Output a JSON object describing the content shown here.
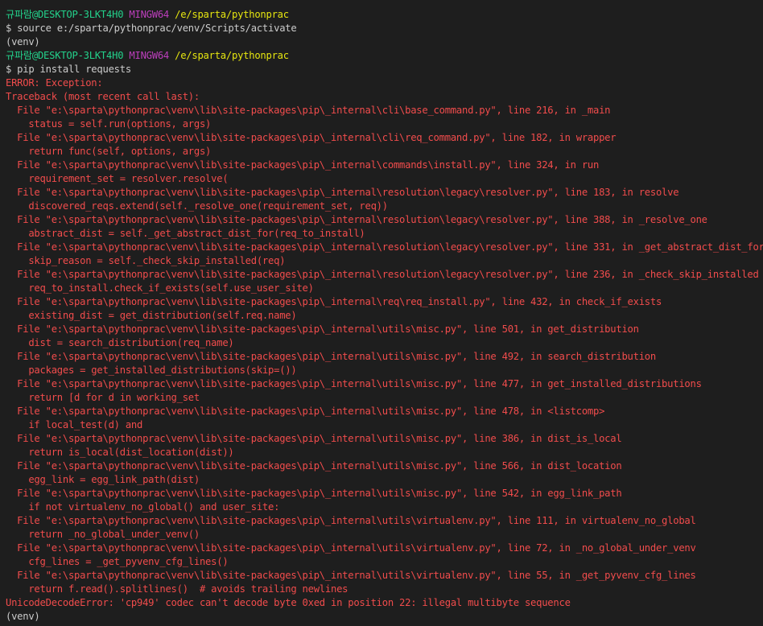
{
  "terminal": {
    "lines": [
      {
        "type": "prompt",
        "user": "규파람@DESKTOP-3LKT4H0",
        "shell": "MINGW64",
        "path": "/e/sparta/pythonprac"
      },
      {
        "type": "plain",
        "text": "$ source e:/sparta/pythonprac/venv/Scripts/activate"
      },
      {
        "type": "plain",
        "text": "(venv)"
      },
      {
        "type": "prompt",
        "user": "규파람@DESKTOP-3LKT4H0",
        "shell": "MINGW64",
        "path": "/e/sparta/pythonprac"
      },
      {
        "type": "plain",
        "text": "$ pip install requests"
      },
      {
        "type": "error",
        "text": "ERROR: Exception:"
      },
      {
        "type": "error",
        "text": "Traceback (most recent call last):"
      },
      {
        "type": "error",
        "text": "  File \"e:\\sparta\\pythonprac\\venv\\lib\\site-packages\\pip\\_internal\\cli\\base_command.py\", line 216, in _main"
      },
      {
        "type": "error",
        "text": "    status = self.run(options, args)"
      },
      {
        "type": "error",
        "text": "  File \"e:\\sparta\\pythonprac\\venv\\lib\\site-packages\\pip\\_internal\\cli\\req_command.py\", line 182, in wrapper"
      },
      {
        "type": "error",
        "text": "    return func(self, options, args)"
      },
      {
        "type": "error",
        "text": "  File \"e:\\sparta\\pythonprac\\venv\\lib\\site-packages\\pip\\_internal\\commands\\install.py\", line 324, in run"
      },
      {
        "type": "error",
        "text": "    requirement_set = resolver.resolve("
      },
      {
        "type": "error",
        "text": "  File \"e:\\sparta\\pythonprac\\venv\\lib\\site-packages\\pip\\_internal\\resolution\\legacy\\resolver.py\", line 183, in resolve"
      },
      {
        "type": "error",
        "text": "    discovered_reqs.extend(self._resolve_one(requirement_set, req))"
      },
      {
        "type": "error",
        "text": "  File \"e:\\sparta\\pythonprac\\venv\\lib\\site-packages\\pip\\_internal\\resolution\\legacy\\resolver.py\", line 388, in _resolve_one"
      },
      {
        "type": "error",
        "text": "    abstract_dist = self._get_abstract_dist_for(req_to_install)"
      },
      {
        "type": "error",
        "text": "  File \"e:\\sparta\\pythonprac\\venv\\lib\\site-packages\\pip\\_internal\\resolution\\legacy\\resolver.py\", line 331, in _get_abstract_dist_for"
      },
      {
        "type": "error",
        "text": "    skip_reason = self._check_skip_installed(req)"
      },
      {
        "type": "error",
        "text": "  File \"e:\\sparta\\pythonprac\\venv\\lib\\site-packages\\pip\\_internal\\resolution\\legacy\\resolver.py\", line 236, in _check_skip_installed"
      },
      {
        "type": "error",
        "text": "    req_to_install.check_if_exists(self.use_user_site)"
      },
      {
        "type": "error",
        "text": "  File \"e:\\sparta\\pythonprac\\venv\\lib\\site-packages\\pip\\_internal\\req\\req_install.py\", line 432, in check_if_exists"
      },
      {
        "type": "error",
        "text": "    existing_dist = get_distribution(self.req.name)"
      },
      {
        "type": "error",
        "text": "  File \"e:\\sparta\\pythonprac\\venv\\lib\\site-packages\\pip\\_internal\\utils\\misc.py\", line 501, in get_distribution"
      },
      {
        "type": "error",
        "text": "    dist = search_distribution(req_name)"
      },
      {
        "type": "error",
        "text": "  File \"e:\\sparta\\pythonprac\\venv\\lib\\site-packages\\pip\\_internal\\utils\\misc.py\", line 492, in search_distribution"
      },
      {
        "type": "error",
        "text": "    packages = get_installed_distributions(skip=())"
      },
      {
        "type": "error",
        "text": "  File \"e:\\sparta\\pythonprac\\venv\\lib\\site-packages\\pip\\_internal\\utils\\misc.py\", line 477, in get_installed_distributions"
      },
      {
        "type": "error",
        "text": "    return [d for d in working_set"
      },
      {
        "type": "error",
        "text": "  File \"e:\\sparta\\pythonprac\\venv\\lib\\site-packages\\pip\\_internal\\utils\\misc.py\", line 478, in <listcomp>"
      },
      {
        "type": "error",
        "text": "    if local_test(d) and"
      },
      {
        "type": "error",
        "text": "  File \"e:\\sparta\\pythonprac\\venv\\lib\\site-packages\\pip\\_internal\\utils\\misc.py\", line 386, in dist_is_local"
      },
      {
        "type": "error",
        "text": "    return is_local(dist_location(dist))"
      },
      {
        "type": "error",
        "text": "  File \"e:\\sparta\\pythonprac\\venv\\lib\\site-packages\\pip\\_internal\\utils\\misc.py\", line 566, in dist_location"
      },
      {
        "type": "error",
        "text": "    egg_link = egg_link_path(dist)"
      },
      {
        "type": "error",
        "text": "  File \"e:\\sparta\\pythonprac\\venv\\lib\\site-packages\\pip\\_internal\\utils\\misc.py\", line 542, in egg_link_path"
      },
      {
        "type": "error",
        "text": "    if not virtualenv_no_global() and user_site:"
      },
      {
        "type": "error",
        "text": "  File \"e:\\sparta\\pythonprac\\venv\\lib\\site-packages\\pip\\_internal\\utils\\virtualenv.py\", line 111, in virtualenv_no_global"
      },
      {
        "type": "error",
        "text": "    return _no_global_under_venv()"
      },
      {
        "type": "error",
        "text": "  File \"e:\\sparta\\pythonprac\\venv\\lib\\site-packages\\pip\\_internal\\utils\\virtualenv.py\", line 72, in _no_global_under_venv"
      },
      {
        "type": "error",
        "text": "    cfg_lines = _get_pyvenv_cfg_lines()"
      },
      {
        "type": "error",
        "text": "  File \"e:\\sparta\\pythonprac\\venv\\lib\\site-packages\\pip\\_internal\\utils\\virtualenv.py\", line 55, in _get_pyvenv_cfg_lines"
      },
      {
        "type": "error",
        "text": "    return f.read().splitlines()  # avoids trailing newlines"
      },
      {
        "type": "error",
        "text": "UnicodeDecodeError: 'cp949' codec can't decode byte 0xed in position 22: illegal multibyte sequence"
      },
      {
        "type": "plain",
        "text": "(venv)"
      }
    ]
  },
  "colors": {
    "background": "#1e1e1e",
    "text": "#cccccc",
    "user": "#23d18b",
    "shell": "#bc3fbc",
    "path": "#e5e510",
    "error": "#f14c4c"
  }
}
